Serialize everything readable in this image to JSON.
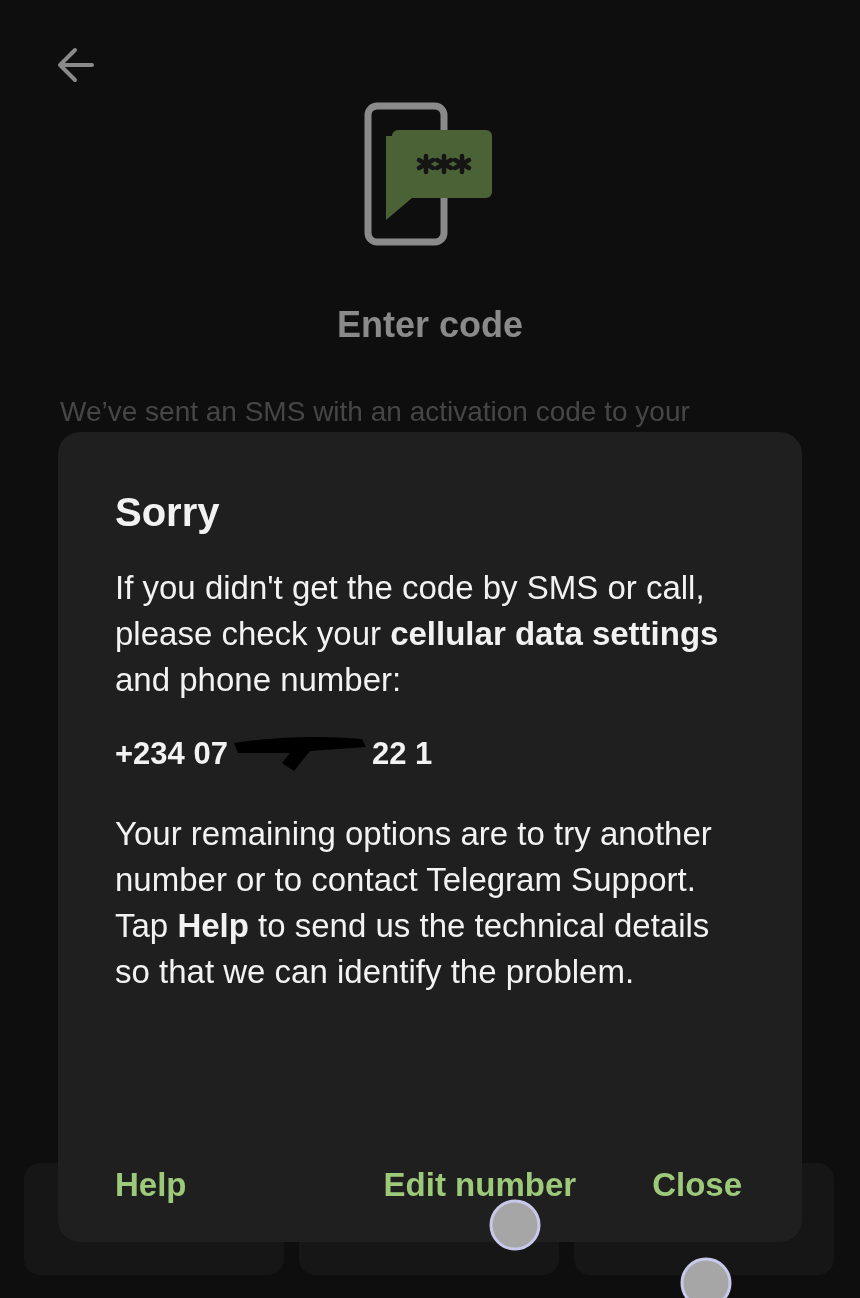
{
  "screen": {
    "title": "Enter code",
    "subtitle": "We’ve sent an SMS with an activation code to your"
  },
  "dialog": {
    "title": "Sorry",
    "message": "If you didn't get the code by SMS or call, please check your **cellular data settings** and phone number:",
    "phone_number_parts": [
      "+234 07",
      "22 1"
    ],
    "details": "Your remaining options are to try another number or to contact Telegram Support. Tap **Help** to send us the technical details so that we can identify the problem.",
    "buttons_left": [
      {
        "label": "Help"
      }
    ],
    "buttons_right": [
      {
        "label": "Edit number"
      },
      {
        "label": "Close"
      }
    ]
  }
}
